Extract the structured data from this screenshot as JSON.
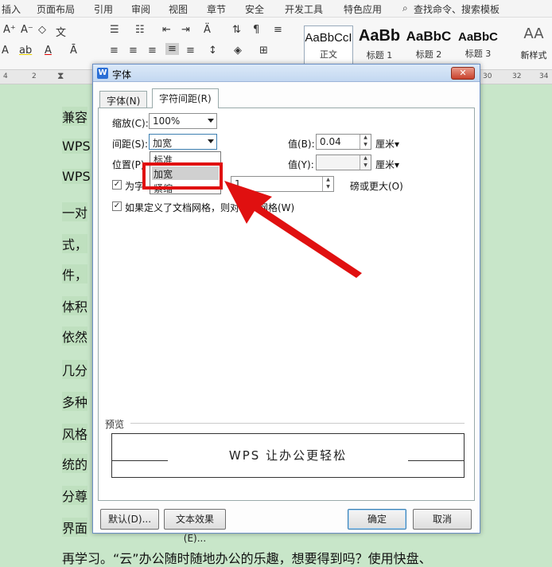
{
  "menubar": {
    "items": [
      "插入",
      "页面布局",
      "引用",
      "审阅",
      "视图",
      "章节",
      "安全",
      "开发工具",
      "特色应用"
    ],
    "search": "查找命令、搜索模板"
  },
  "ribbon": {
    "styles": [
      {
        "sample": "AaBbCcI",
        "label": "正文"
      },
      {
        "sample": "AaBb",
        "label": "标题 1"
      },
      {
        "sample": "AaBbC",
        "label": "标题 2"
      },
      {
        "sample": "AaBbC",
        "label": "标题 3"
      }
    ],
    "new_style_label": "新样式"
  },
  "ruler": {
    "ticks": [
      "4",
      "2",
      "30",
      "32",
      "34"
    ]
  },
  "document": {
    "lines": [
      "兼容",
      "WPS",
      "WPS",
      "一对",
      "式，",
      "件，",
      "体积",
      "依然",
      "几分",
      "多种",
      "风格",
      "统的",
      "分尊",
      "界面",
      "再学习。“云”办公随时随地办公的乐趣，想要得到吗？使用快盘、"
    ]
  },
  "dialog": {
    "title": "字体",
    "tabs": [
      "字体(N)",
      "字符间距(R)"
    ],
    "scale_label": "缩放(C):",
    "scale_value": "100%",
    "spacing_label": "间距(S):",
    "spacing_value": "加宽",
    "spacing_amount_label": "值(B):",
    "spacing_amount_value": "0.04",
    "unit_cm": "厘米",
    "position_label": "位置(P)",
    "position_amount_label": "值(Y):",
    "position_amount_value": "",
    "kerning_label": "为字",
    "kerning_value": "1",
    "kerning_suffix": "磅或更大(O)",
    "grid_label": "如果定义了文档网格，则对齐到网格(W)",
    "dropdown_options": [
      "标准",
      "加宽",
      "紧缩"
    ],
    "dropdown_selected": "加宽",
    "preview_label": "预览",
    "preview_text": "WPS 让办公更轻松",
    "default_button": "默认(D)...",
    "text_effect_button": "文本效果(E)...",
    "ok_button": "确定",
    "cancel_button": "取消"
  },
  "colors": {
    "accent_red": "#e01010",
    "doc_background": "#c8e6c9"
  }
}
